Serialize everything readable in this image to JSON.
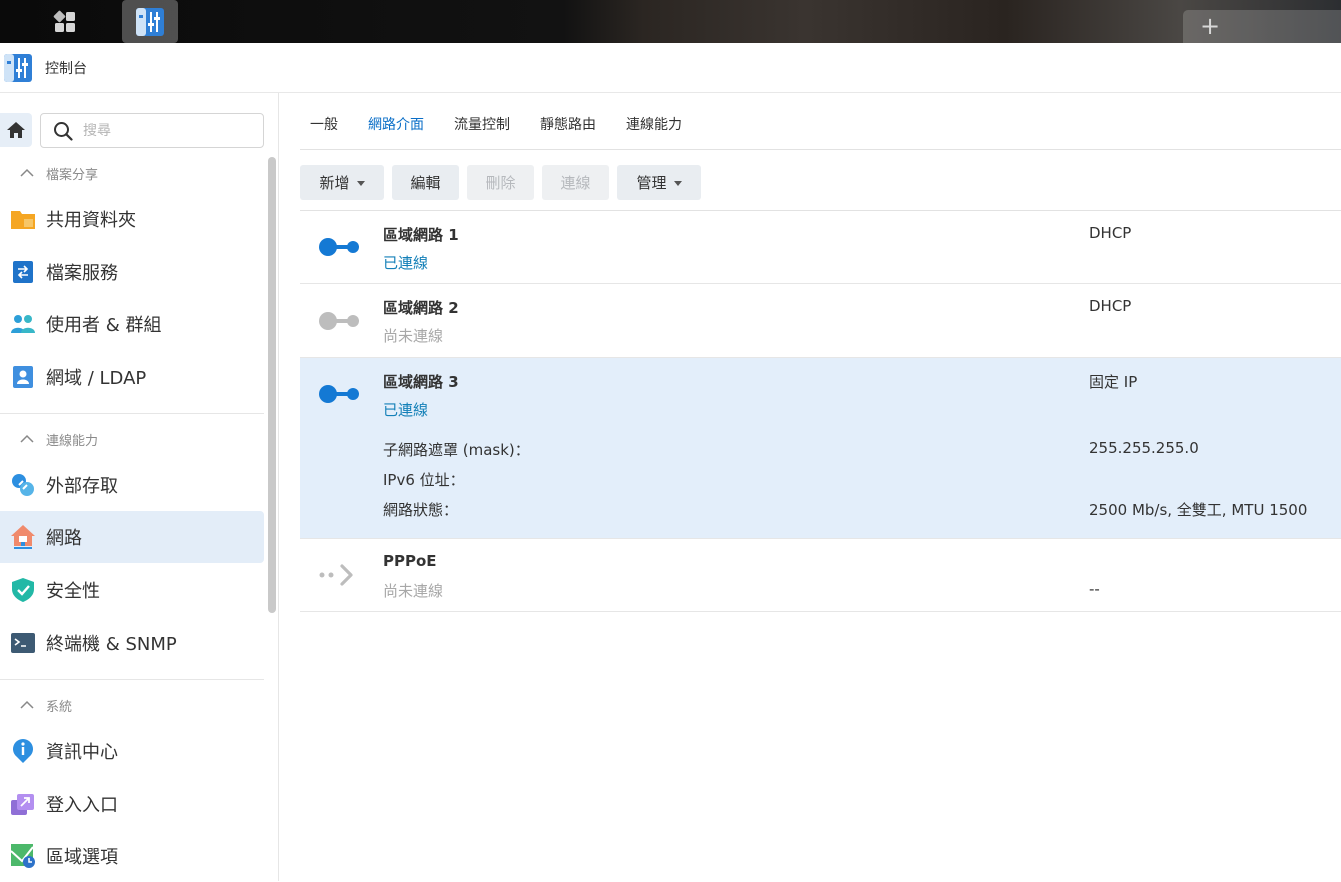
{
  "app": {
    "title": "控制台"
  },
  "search": {
    "placeholder": "搜尋"
  },
  "sidebar": {
    "groups": [
      {
        "label": "檔案分享",
        "items": [
          "共用資料夾",
          "檔案服務",
          "使用者 & 群組",
          "網域 / LDAP"
        ]
      },
      {
        "label": "連線能力",
        "items": [
          "外部存取",
          "網路",
          "安全性",
          "終端機 & SNMP"
        ]
      },
      {
        "label": "系統",
        "items": [
          "資訊中心",
          "登入入口",
          "區域選項"
        ]
      }
    ],
    "active_item": "網路"
  },
  "tabs": [
    "一般",
    "網路介面",
    "流量控制",
    "靜態路由",
    "連線能力"
  ],
  "active_tab": "網路介面",
  "toolbar": {
    "add": "新增",
    "edit": "編輯",
    "delete": "刪除",
    "connect": "連線",
    "manage": "管理"
  },
  "interfaces": [
    {
      "name": "區域網路 1",
      "status": "已連線",
      "type": "DHCP"
    },
    {
      "name": "區域網路 2",
      "status": "尚未連線",
      "type": "DHCP"
    },
    {
      "name": "區域網路 3",
      "status": "已連線",
      "type": "固定 IP",
      "details": [
        {
          "label": "子網路遮罩 (mask)：",
          "value": "255.255.255.0"
        },
        {
          "label": "IPv6 位址：",
          "value": ""
        },
        {
          "label": "網路狀態：",
          "value": "2500 Mb/s, 全雙工, MTU 1500"
        }
      ]
    },
    {
      "name": "PPPoE",
      "status": "尚未連線",
      "type": "--"
    }
  ],
  "colors": {
    "accent": "#0a6ec7",
    "connected": "#1480b8",
    "selected_row": "#e3eefa"
  }
}
